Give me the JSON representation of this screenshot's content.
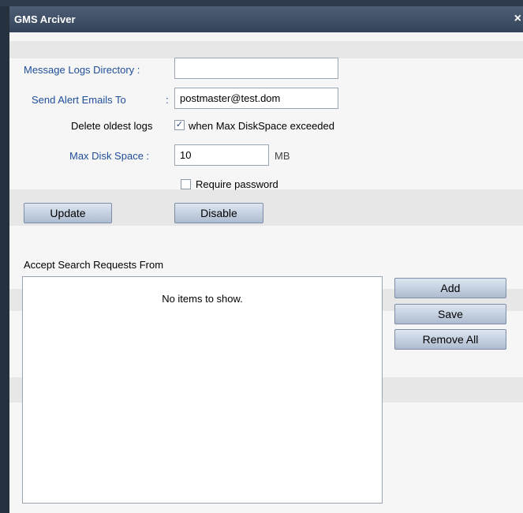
{
  "window": {
    "title": "GMS Arciver",
    "close_glyph": "×"
  },
  "form": {
    "message_logs_dir_label": "Message Logs Directory :",
    "message_logs_dir_value": "",
    "send_alert_label": "Send Alert Emails To",
    "send_alert_colon": ":",
    "send_alert_value": "postmaster@test.dom",
    "delete_oldest_label": "Delete oldest logs",
    "delete_oldest_checked": true,
    "delete_oldest_suffix": "when Max DiskSpace exceeded",
    "max_disk_label": "Max Disk Space :",
    "max_disk_value": "10",
    "max_disk_unit": "MB",
    "require_password_label": "Require password",
    "require_password_checked": false
  },
  "buttons": {
    "update": "Update",
    "disable": "Disable",
    "add": "Add",
    "save": "Save",
    "remove_all": "Remove All"
  },
  "search": {
    "heading": "Accept Search Requests From",
    "empty_text": "No items to show."
  },
  "icons": {
    "close": "close-icon",
    "check": "checkmark-icon"
  },
  "colors": {
    "title_bar": "#3d4d63",
    "label_blue": "#1f4e9a",
    "button_top": "#dde6f1",
    "button_bottom": "#aebcd0"
  }
}
